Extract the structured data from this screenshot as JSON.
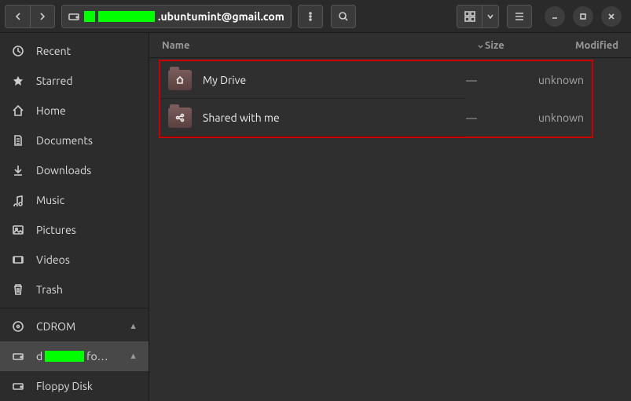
{
  "titlebar": {
    "path_suffix": ".ubuntumint@gmail.com"
  },
  "sidebar": {
    "items": [
      {
        "label": "Recent",
        "icon": "clock"
      },
      {
        "label": "Starred",
        "icon": "star"
      },
      {
        "label": "Home",
        "icon": "home"
      },
      {
        "label": "Documents",
        "icon": "document"
      },
      {
        "label": "Downloads",
        "icon": "downloads"
      },
      {
        "label": "Music",
        "icon": "music"
      },
      {
        "label": "Pictures",
        "icon": "pictures"
      },
      {
        "label": "Videos",
        "icon": "videos"
      },
      {
        "label": "Trash",
        "icon": "trash"
      }
    ],
    "volumes": [
      {
        "label": "CDROM",
        "icon": "disc",
        "ejectable": true,
        "selected": false,
        "redacted": false
      },
      {
        "label": "fo…",
        "icon": "drive",
        "ejectable": true,
        "selected": true,
        "redacted": true,
        "prefix": "d"
      },
      {
        "label": "Floppy Disk",
        "icon": "drive",
        "ejectable": false,
        "selected": false,
        "redacted": false
      }
    ]
  },
  "columns": {
    "name": "Name",
    "size": "Size",
    "modified": "Modified"
  },
  "files": [
    {
      "name": "My Drive",
      "icon": "home",
      "size": "—",
      "modified": "unknown"
    },
    {
      "name": "Shared with me",
      "icon": "share",
      "size": "—",
      "modified": "unknown"
    }
  ]
}
